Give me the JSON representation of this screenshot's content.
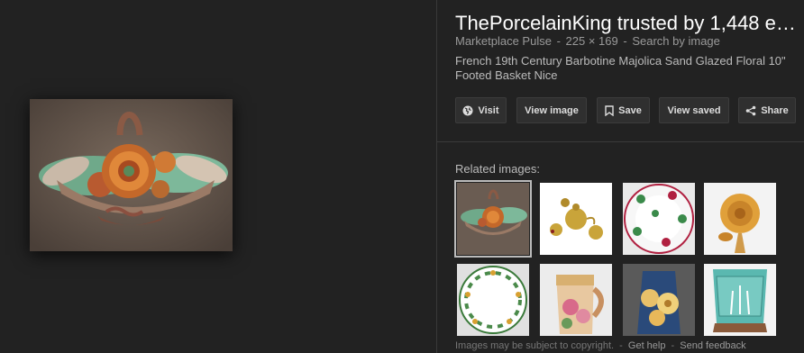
{
  "panel": {
    "title": "ThePorcelainKing trusted by 1,448 e…",
    "source": "Marketplace Pulse",
    "dimensions": "225 × 169",
    "search_by_image": "Search by image",
    "separator": "-",
    "description": "French 19th Century Barbotine Majolica Sand Glazed Floral 10\" Footed Basket Nice"
  },
  "buttons": {
    "visit": "Visit",
    "view_image": "View image",
    "save": "Save",
    "view_saved": "View saved",
    "share": "Share"
  },
  "related": {
    "label": "Related images:",
    "items": [
      {
        "name": "majolica-basket"
      },
      {
        "name": "brass-tea-set"
      },
      {
        "name": "floral-plate"
      },
      {
        "name": "gold-flower"
      },
      {
        "name": "green-flower-plate"
      },
      {
        "name": "majolica-pitcher"
      },
      {
        "name": "flower-vase"
      },
      {
        "name": "turquoise-planter"
      }
    ]
  },
  "footer": {
    "copyright": "Images may be subject to copyright.",
    "get_help": "Get help",
    "send_feedback": "Send feedback",
    "separator": "-"
  },
  "colors": {
    "background": "#222222",
    "button_bg": "#2f2f2f",
    "title": "#ffffff"
  }
}
